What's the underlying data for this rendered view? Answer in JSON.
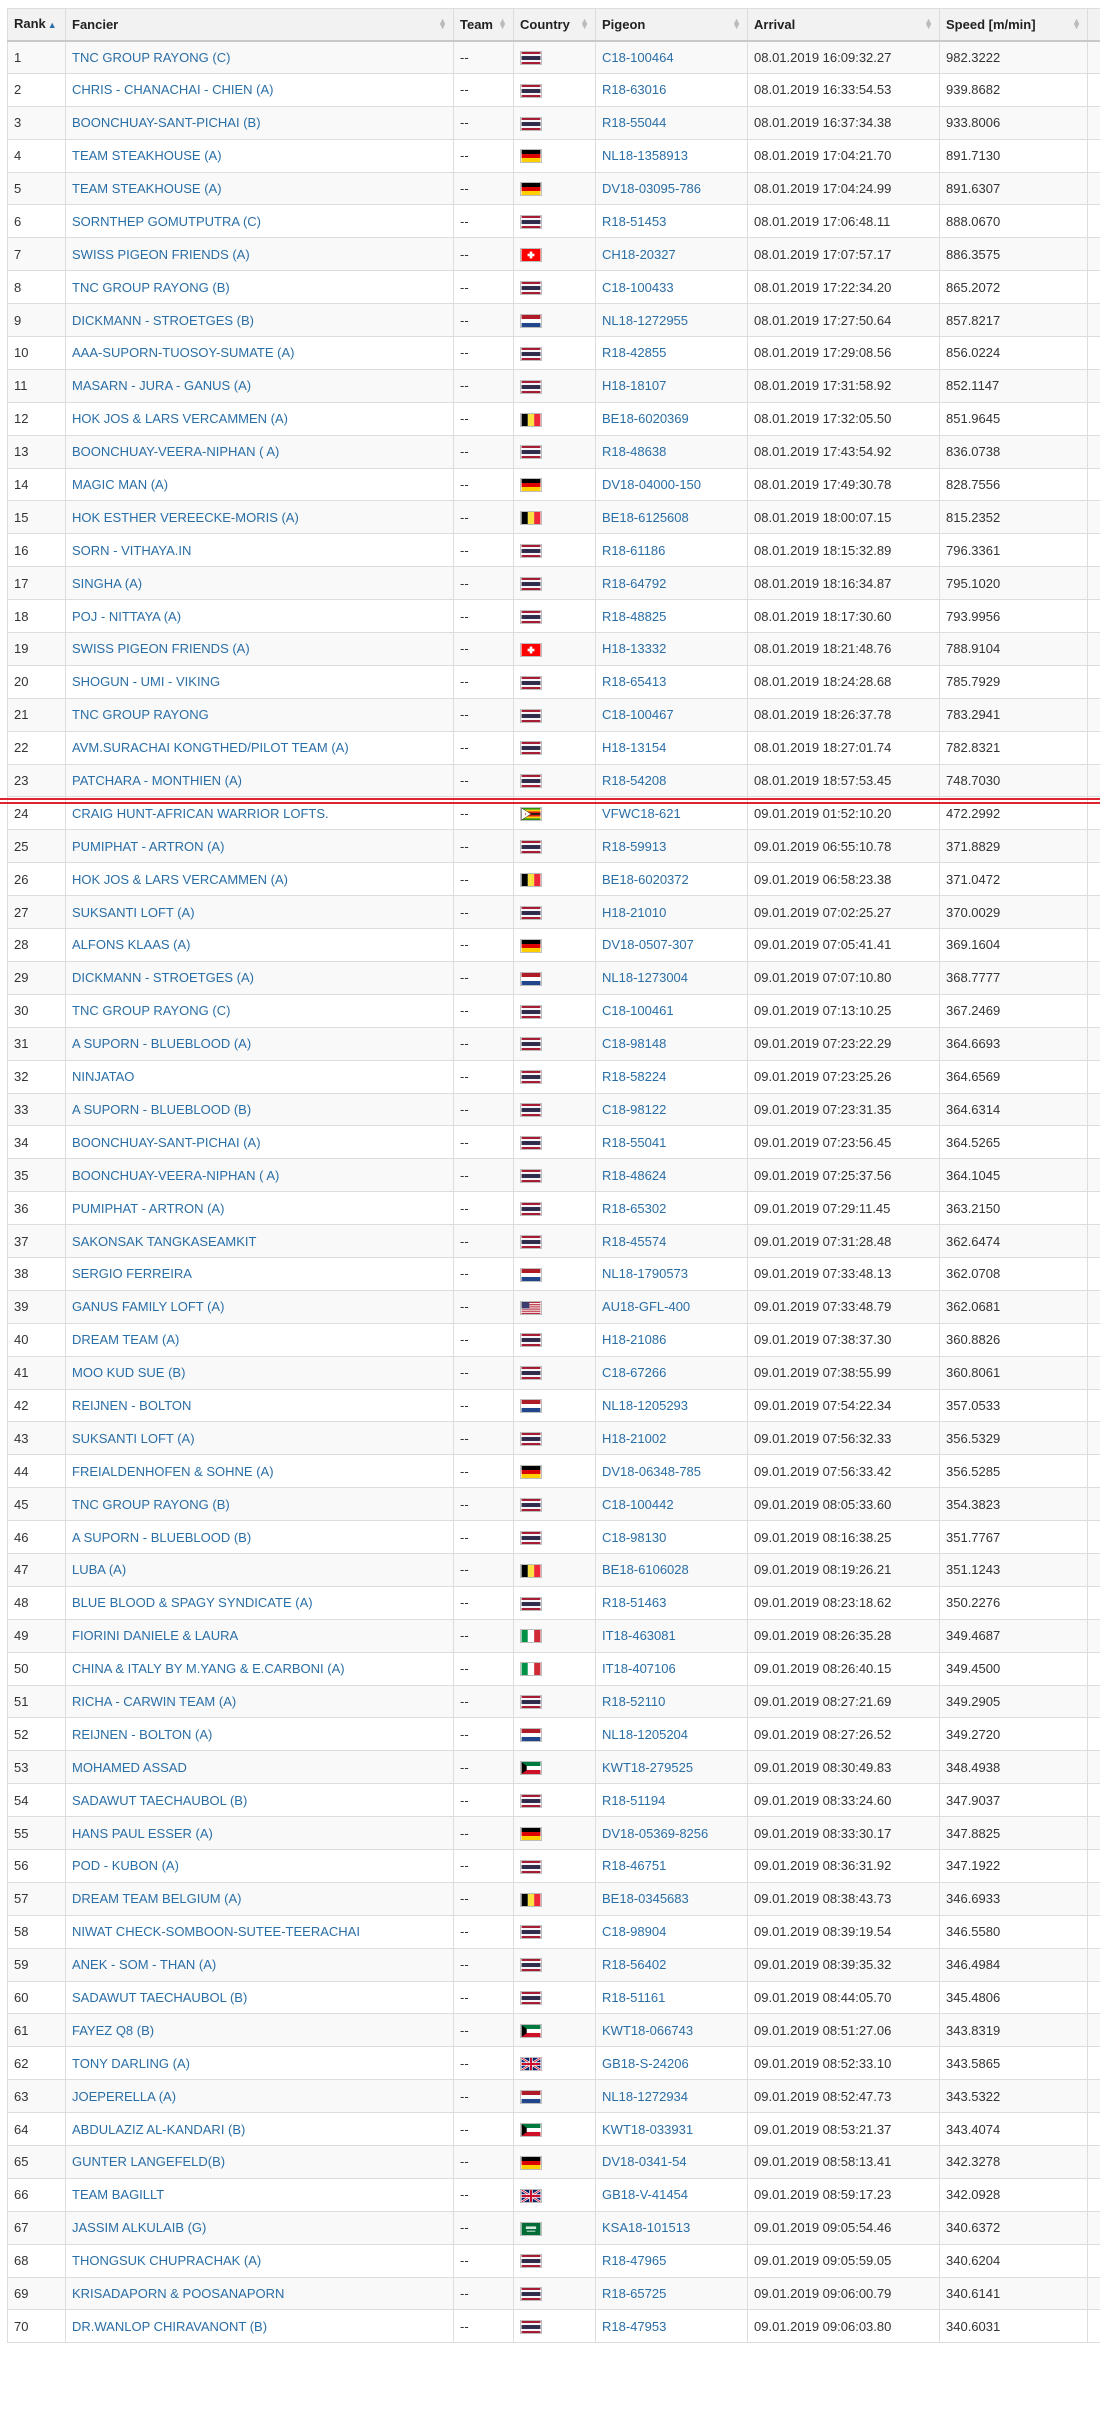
{
  "table": {
    "headers": {
      "rank": "Rank",
      "fancier": "Fancier",
      "team": "Team",
      "country": "Country",
      "pigeon": "Pigeon",
      "arrival": "Arrival",
      "speed": "Speed [m/min]"
    },
    "sort": {
      "column": "rank",
      "direction": "ascending",
      "icon": "sort-asc-icon"
    },
    "prize_line_after_rank": 23,
    "prize_line_color": "#e0242f",
    "rows": [
      {
        "rank": "1",
        "fancier": "TNC GROUP RAYONG (C)",
        "team": "--",
        "flag": "thailand",
        "pigeon": "C18-100464",
        "arrival": "08.01.2019 16:09:32.27",
        "speed": "982.3222"
      },
      {
        "rank": "2",
        "fancier": "CHRIS - CHANACHAI - CHIEN (A)",
        "team": "--",
        "flag": "thailand",
        "pigeon": "R18-63016",
        "arrival": "08.01.2019 16:33:54.53",
        "speed": "939.8682"
      },
      {
        "rank": "3",
        "fancier": "BOONCHUAY-SANT-PICHAI (B)",
        "team": "--",
        "flag": "thailand",
        "pigeon": "R18-55044",
        "arrival": "08.01.2019 16:37:34.38",
        "speed": "933.8006"
      },
      {
        "rank": "4",
        "fancier": "TEAM STEAKHOUSE (A)",
        "team": "--",
        "flag": "germany",
        "pigeon": "NL18-1358913",
        "arrival": "08.01.2019 17:04:21.70",
        "speed": "891.7130"
      },
      {
        "rank": "5",
        "fancier": "TEAM STEAKHOUSE (A)",
        "team": "--",
        "flag": "germany",
        "pigeon": "DV18-03095-786",
        "arrival": "08.01.2019 17:04:24.99",
        "speed": "891.6307"
      },
      {
        "rank": "6",
        "fancier": "SORNTHEP GOMUTPUTRA (C)",
        "team": "--",
        "flag": "thailand",
        "pigeon": "R18-51453",
        "arrival": "08.01.2019 17:06:48.11",
        "speed": "888.0670"
      },
      {
        "rank": "7",
        "fancier": "SWISS PIGEON FRIENDS (A)",
        "team": "--",
        "flag": "switzerland",
        "pigeon": "CH18-20327",
        "arrival": "08.01.2019 17:07:57.17",
        "speed": "886.3575"
      },
      {
        "rank": "8",
        "fancier": "TNC GROUP RAYONG (B)",
        "team": "--",
        "flag": "thailand",
        "pigeon": "C18-100433",
        "arrival": "08.01.2019 17:22:34.20",
        "speed": "865.2072"
      },
      {
        "rank": "9",
        "fancier": "DICKMANN - STROETGES (B)",
        "team": "--",
        "flag": "netherlands",
        "pigeon": "NL18-1272955",
        "arrival": "08.01.2019 17:27:50.64",
        "speed": "857.8217"
      },
      {
        "rank": "10",
        "fancier": "AAA-SUPORN-TUOSOY-SUMATE (A)",
        "team": "--",
        "flag": "thailand",
        "pigeon": "R18-42855",
        "arrival": "08.01.2019 17:29:08.56",
        "speed": "856.0224"
      },
      {
        "rank": "11",
        "fancier": "MASARN - JURA - GANUS (A)",
        "team": "--",
        "flag": "thailand",
        "pigeon": "H18-18107",
        "arrival": "08.01.2019 17:31:58.92",
        "speed": "852.1147"
      },
      {
        "rank": "12",
        "fancier": "HOK JOS & LARS VERCAMMEN (A)",
        "team": "--",
        "flag": "belgium",
        "pigeon": "BE18-6020369",
        "arrival": "08.01.2019 17:32:05.50",
        "speed": "851.9645"
      },
      {
        "rank": "13",
        "fancier": "BOONCHUAY-VEERA-NIPHAN ( A)",
        "team": "--",
        "flag": "thailand",
        "pigeon": "R18-48638",
        "arrival": "08.01.2019 17:43:54.92",
        "speed": "836.0738"
      },
      {
        "rank": "14",
        "fancier": "MAGIC MAN (A)",
        "team": "--",
        "flag": "germany",
        "pigeon": "DV18-04000-150",
        "arrival": "08.01.2019 17:49:30.78",
        "speed": "828.7556"
      },
      {
        "rank": "15",
        "fancier": "HOK ESTHER VEREECKE-MORIS (A)",
        "team": "--",
        "flag": "belgium",
        "pigeon": "BE18-6125608",
        "arrival": "08.01.2019 18:00:07.15",
        "speed": "815.2352"
      },
      {
        "rank": "16",
        "fancier": "SORN - VITHAYA.IN",
        "team": "--",
        "flag": "thailand",
        "pigeon": "R18-61186",
        "arrival": "08.01.2019 18:15:32.89",
        "speed": "796.3361"
      },
      {
        "rank": "17",
        "fancier": "SINGHA (A)",
        "team": "--",
        "flag": "thailand",
        "pigeon": "R18-64792",
        "arrival": "08.01.2019 18:16:34.87",
        "speed": "795.1020"
      },
      {
        "rank": "18",
        "fancier": "POJ - NITTAYA (A)",
        "team": "--",
        "flag": "thailand",
        "pigeon": "R18-48825",
        "arrival": "08.01.2019 18:17:30.60",
        "speed": "793.9956"
      },
      {
        "rank": "19",
        "fancier": "SWISS PIGEON FRIENDS (A)",
        "team": "--",
        "flag": "switzerland",
        "pigeon": "H18-13332",
        "arrival": "08.01.2019 18:21:48.76",
        "speed": "788.9104"
      },
      {
        "rank": "20",
        "fancier": "SHOGUN - UMI - VIKING",
        "team": "--",
        "flag": "thailand",
        "pigeon": "R18-65413",
        "arrival": "08.01.2019 18:24:28.68",
        "speed": "785.7929"
      },
      {
        "rank": "21",
        "fancier": "TNC GROUP RAYONG",
        "team": "--",
        "flag": "thailand",
        "pigeon": "C18-100467",
        "arrival": "08.01.2019 18:26:37.78",
        "speed": "783.2941"
      },
      {
        "rank": "22",
        "fancier": "AVM.SURACHAI KONGTHED/PILOT TEAM (A)",
        "team": "--",
        "flag": "thailand",
        "pigeon": "H18-13154",
        "arrival": "08.01.2019 18:27:01.74",
        "speed": "782.8321"
      },
      {
        "rank": "23",
        "fancier": "PATCHARA - MONTHIEN (A)",
        "team": "--",
        "flag": "thailand",
        "pigeon": "R18-54208",
        "arrival": "08.01.2019 18:57:53.45",
        "speed": "748.7030"
      },
      {
        "rank": "24",
        "fancier": "CRAIG HUNT-AFRICAN WARRIOR LOFTS.",
        "team": "--",
        "flag": "zimbabwe",
        "pigeon": "VFWC18-621",
        "arrival": "09.01.2019 01:52:10.20",
        "speed": "472.2992"
      },
      {
        "rank": "25",
        "fancier": "PUMIPHAT - ARTRON (A)",
        "team": "--",
        "flag": "thailand",
        "pigeon": "R18-59913",
        "arrival": "09.01.2019 06:55:10.78",
        "speed": "371.8829"
      },
      {
        "rank": "26",
        "fancier": "HOK JOS & LARS VERCAMMEN (A)",
        "team": "--",
        "flag": "belgium",
        "pigeon": "BE18-6020372",
        "arrival": "09.01.2019 06:58:23.38",
        "speed": "371.0472"
      },
      {
        "rank": "27",
        "fancier": "SUKSANTI LOFT (A)",
        "team": "--",
        "flag": "thailand",
        "pigeon": "H18-21010",
        "arrival": "09.01.2019 07:02:25.27",
        "speed": "370.0029"
      },
      {
        "rank": "28",
        "fancier": "ALFONS KLAAS (A)",
        "team": "--",
        "flag": "germany",
        "pigeon": "DV18-0507-307",
        "arrival": "09.01.2019 07:05:41.41",
        "speed": "369.1604"
      },
      {
        "rank": "29",
        "fancier": "DICKMANN - STROETGES (A)",
        "team": "--",
        "flag": "netherlands",
        "pigeon": "NL18-1273004",
        "arrival": "09.01.2019 07:07:10.80",
        "speed": "368.7777"
      },
      {
        "rank": "30",
        "fancier": "TNC GROUP RAYONG (C)",
        "team": "--",
        "flag": "thailand",
        "pigeon": "C18-100461",
        "arrival": "09.01.2019 07:13:10.25",
        "speed": "367.2469"
      },
      {
        "rank": "31",
        "fancier": "A SUPORN - BLUEBLOOD (A)",
        "team": "--",
        "flag": "thailand",
        "pigeon": "C18-98148",
        "arrival": "09.01.2019 07:23:22.29",
        "speed": "364.6693"
      },
      {
        "rank": "32",
        "fancier": "NINJATAO",
        "team": "--",
        "flag": "thailand",
        "pigeon": "R18-58224",
        "arrival": "09.01.2019 07:23:25.26",
        "speed": "364.6569"
      },
      {
        "rank": "33",
        "fancier": "A SUPORN - BLUEBLOOD (B)",
        "team": "--",
        "flag": "thailand",
        "pigeon": "C18-98122",
        "arrival": "09.01.2019 07:23:31.35",
        "speed": "364.6314"
      },
      {
        "rank": "34",
        "fancier": "BOONCHUAY-SANT-PICHAI (A)",
        "team": "--",
        "flag": "thailand",
        "pigeon": "R18-55041",
        "arrival": "09.01.2019 07:23:56.45",
        "speed": "364.5265"
      },
      {
        "rank": "35",
        "fancier": "BOONCHUAY-VEERA-NIPHAN ( A)",
        "team": "--",
        "flag": "thailand",
        "pigeon": "R18-48624",
        "arrival": "09.01.2019 07:25:37.56",
        "speed": "364.1045"
      },
      {
        "rank": "36",
        "fancier": "PUMIPHAT - ARTRON (A)",
        "team": "--",
        "flag": "thailand",
        "pigeon": "R18-65302",
        "arrival": "09.01.2019 07:29:11.45",
        "speed": "363.2150"
      },
      {
        "rank": "37",
        "fancier": "SAKONSAK TANGKASEAMKIT",
        "team": "--",
        "flag": "thailand",
        "pigeon": "R18-45574",
        "arrival": "09.01.2019 07:31:28.48",
        "speed": "362.6474"
      },
      {
        "rank": "38",
        "fancier": "SERGIO FERREIRA",
        "team": "--",
        "flag": "netherlands",
        "pigeon": "NL18-1790573",
        "arrival": "09.01.2019 07:33:48.13",
        "speed": "362.0708"
      },
      {
        "rank": "39",
        "fancier": "GANUS FAMILY LOFT (A)",
        "team": "--",
        "flag": "usa",
        "pigeon": "AU18-GFL-400",
        "arrival": "09.01.2019 07:33:48.79",
        "speed": "362.0681"
      },
      {
        "rank": "40",
        "fancier": "DREAM TEAM (A)",
        "team": "--",
        "flag": "thailand",
        "pigeon": "H18-21086",
        "arrival": "09.01.2019 07:38:37.30",
        "speed": "360.8826"
      },
      {
        "rank": "41",
        "fancier": "MOO KUD SUE (B)",
        "team": "--",
        "flag": "thailand",
        "pigeon": "C18-67266",
        "arrival": "09.01.2019 07:38:55.99",
        "speed": "360.8061"
      },
      {
        "rank": "42",
        "fancier": "REIJNEN - BOLTON",
        "team": "--",
        "flag": "netherlands",
        "pigeon": "NL18-1205293",
        "arrival": "09.01.2019 07:54:22.34",
        "speed": "357.0533"
      },
      {
        "rank": "43",
        "fancier": "SUKSANTI LOFT (A)",
        "team": "--",
        "flag": "thailand",
        "pigeon": "H18-21002",
        "arrival": "09.01.2019 07:56:32.33",
        "speed": "356.5329"
      },
      {
        "rank": "44",
        "fancier": "FREIALDENHOFEN & SOHNE (A)",
        "team": "--",
        "flag": "germany",
        "pigeon": "DV18-06348-785",
        "arrival": "09.01.2019 07:56:33.42",
        "speed": "356.5285"
      },
      {
        "rank": "45",
        "fancier": "TNC GROUP RAYONG (B)",
        "team": "--",
        "flag": "thailand",
        "pigeon": "C18-100442",
        "arrival": "09.01.2019 08:05:33.60",
        "speed": "354.3823"
      },
      {
        "rank": "46",
        "fancier": "A SUPORN - BLUEBLOOD (B)",
        "team": "--",
        "flag": "thailand",
        "pigeon": "C18-98130",
        "arrival": "09.01.2019 08:16:38.25",
        "speed": "351.7767"
      },
      {
        "rank": "47",
        "fancier": "LUBA (A)",
        "team": "--",
        "flag": "belgium",
        "pigeon": "BE18-6106028",
        "arrival": "09.01.2019 08:19:26.21",
        "speed": "351.1243"
      },
      {
        "rank": "48",
        "fancier": "BLUE BLOOD & SPAGY SYNDICATE (A)",
        "team": "--",
        "flag": "thailand",
        "pigeon": "R18-51463",
        "arrival": "09.01.2019 08:23:18.62",
        "speed": "350.2276"
      },
      {
        "rank": "49",
        "fancier": "FIORINI DANIELE & LAURA",
        "team": "--",
        "flag": "italy",
        "pigeon": "IT18-463081",
        "arrival": "09.01.2019 08:26:35.28",
        "speed": "349.4687"
      },
      {
        "rank": "50",
        "fancier": "CHINA & ITALY BY M.YANG & E.CARBONI (A)",
        "team": "--",
        "flag": "italy",
        "pigeon": "IT18-407106",
        "arrival": "09.01.2019 08:26:40.15",
        "speed": "349.4500"
      },
      {
        "rank": "51",
        "fancier": "RICHA - CARWIN TEAM (A)",
        "team": "--",
        "flag": "thailand",
        "pigeon": "R18-52110",
        "arrival": "09.01.2019 08:27:21.69",
        "speed": "349.2905"
      },
      {
        "rank": "52",
        "fancier": "REIJNEN - BOLTON (A)",
        "team": "--",
        "flag": "netherlands",
        "pigeon": "NL18-1205204",
        "arrival": "09.01.2019 08:27:26.52",
        "speed": "349.2720"
      },
      {
        "rank": "53",
        "fancier": "MOHAMED ASSAD",
        "team": "--",
        "flag": "kuwait",
        "pigeon": "KWT18-279525",
        "arrival": "09.01.2019 08:30:49.83",
        "speed": "348.4938"
      },
      {
        "rank": "54",
        "fancier": "SADAWUT TAECHAUBOL (B)",
        "team": "--",
        "flag": "thailand",
        "pigeon": "R18-51194",
        "arrival": "09.01.2019 08:33:24.60",
        "speed": "347.9037"
      },
      {
        "rank": "55",
        "fancier": "HANS PAUL ESSER (A)",
        "team": "--",
        "flag": "germany",
        "pigeon": "DV18-05369-8256",
        "arrival": "09.01.2019 08:33:30.17",
        "speed": "347.8825"
      },
      {
        "rank": "56",
        "fancier": "POD - KUBON (A)",
        "team": "--",
        "flag": "thailand",
        "pigeon": "R18-46751",
        "arrival": "09.01.2019 08:36:31.92",
        "speed": "347.1922"
      },
      {
        "rank": "57",
        "fancier": "DREAM TEAM BELGIUM (A)",
        "team": "--",
        "flag": "belgium",
        "pigeon": "BE18-0345683",
        "arrival": "09.01.2019 08:38:43.73",
        "speed": "346.6933"
      },
      {
        "rank": "58",
        "fancier": "NIWAT CHECK-SOMBOON-SUTEE-TEERACHAI",
        "team": "--",
        "flag": "thailand",
        "pigeon": "C18-98904",
        "arrival": "09.01.2019 08:39:19.54",
        "speed": "346.5580"
      },
      {
        "rank": "59",
        "fancier": "ANEK - SOM - THAN (A)",
        "team": "--",
        "flag": "thailand",
        "pigeon": "R18-56402",
        "arrival": "09.01.2019 08:39:35.32",
        "speed": "346.4984"
      },
      {
        "rank": "60",
        "fancier": "SADAWUT TAECHAUBOL (B)",
        "team": "--",
        "flag": "thailand",
        "pigeon": "R18-51161",
        "arrival": "09.01.2019 08:44:05.70",
        "speed": "345.4806"
      },
      {
        "rank": "61",
        "fancier": "FAYEZ Q8 (B)",
        "team": "--",
        "flag": "kuwait",
        "pigeon": "KWT18-066743",
        "arrival": "09.01.2019 08:51:27.06",
        "speed": "343.8319"
      },
      {
        "rank": "62",
        "fancier": "TONY DARLING (A)",
        "team": "--",
        "flag": "uk",
        "pigeon": "GB18-S-24206",
        "arrival": "09.01.2019 08:52:33.10",
        "speed": "343.5865"
      },
      {
        "rank": "63",
        "fancier": "JOEPERELLA (A)",
        "team": "--",
        "flag": "netherlands",
        "pigeon": "NL18-1272934",
        "arrival": "09.01.2019 08:52:47.73",
        "speed": "343.5322"
      },
      {
        "rank": "64",
        "fancier": "ABDULAZIZ AL-KANDARI (B)",
        "team": "--",
        "flag": "kuwait",
        "pigeon": "KWT18-033931",
        "arrival": "09.01.2019 08:53:21.37",
        "speed": "343.4074"
      },
      {
        "rank": "65",
        "fancier": "GUNTER LANGEFELD(B)",
        "team": "--",
        "flag": "germany",
        "pigeon": "DV18-0341-54",
        "arrival": "09.01.2019 08:58:13.41",
        "speed": "342.3278"
      },
      {
        "rank": "66",
        "fancier": "TEAM BAGILLT",
        "team": "--",
        "flag": "uk",
        "pigeon": "GB18-V-41454",
        "arrival": "09.01.2019 08:59:17.23",
        "speed": "342.0928"
      },
      {
        "rank": "67",
        "fancier": "JASSIM ALKULAIB (G)",
        "team": "--",
        "flag": "saudi-arabia",
        "pigeon": "KSA18-101513",
        "arrival": "09.01.2019 09:05:54.46",
        "speed": "340.6372"
      },
      {
        "rank": "68",
        "fancier": "THONGSUK CHUPRACHAK (A)",
        "team": "--",
        "flag": "thailand",
        "pigeon": "R18-47965",
        "arrival": "09.01.2019 09:05:59.05",
        "speed": "340.6204"
      },
      {
        "rank": "69",
        "fancier": "KRISADAPORN & POOSANAPORN",
        "team": "--",
        "flag": "thailand",
        "pigeon": "R18-65725",
        "arrival": "09.01.2019 09:06:00.79",
        "speed": "340.6141"
      },
      {
        "rank": "70",
        "fancier": "DR.WANLOP CHIRAVANONT (B)",
        "team": "--",
        "flag": "thailand",
        "pigeon": "R18-47953",
        "arrival": "09.01.2019 09:06:03.80",
        "speed": "340.6031"
      }
    ]
  }
}
